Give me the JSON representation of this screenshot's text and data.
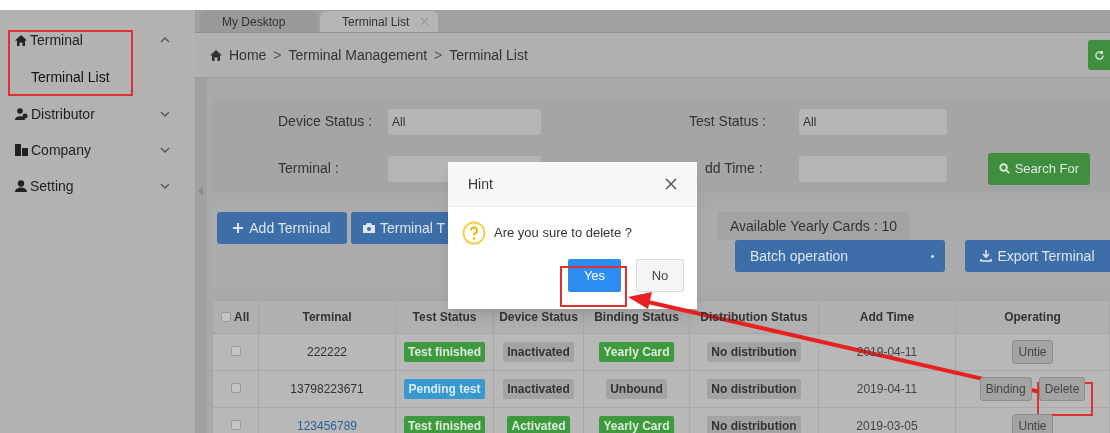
{
  "sidebar": {
    "items": [
      {
        "label": "Terminal",
        "expanded": true,
        "children": [
          {
            "label": "Terminal List",
            "selected": true
          }
        ]
      },
      {
        "label": "Distributor",
        "expanded": false
      },
      {
        "label": "Company",
        "expanded": false
      },
      {
        "label": "Setting",
        "expanded": false
      }
    ]
  },
  "tabs": [
    {
      "label": "My Desktop",
      "selected": false,
      "closable": false
    },
    {
      "label": "Terminal List",
      "selected": true,
      "closable": true
    }
  ],
  "breadcrumb": {
    "items": [
      "Home",
      "Terminal Management",
      "Terminal List"
    ],
    "separator": ">"
  },
  "filters": [
    {
      "label": "Device Status :",
      "value": "All"
    },
    {
      "label": "Test Status :",
      "value": "All"
    },
    {
      "label": "Terminal :"
    },
    {
      "label": "dd Time :"
    }
  ],
  "search_button": "Search For",
  "toolbar": {
    "buttons": [
      "Add Terminal",
      "Terminal T"
    ],
    "yearly_cards": "Available Yearly Cards : 10",
    "batch": "Batch operation",
    "export": "Export Terminal"
  },
  "table": {
    "columns": [
      "All",
      "Terminal",
      "Test Status",
      "Device Status",
      "Binding Status",
      "Distribution Status",
      "Add Time",
      "Operating"
    ],
    "all_checked": false,
    "rows": [
      {
        "checked": false,
        "terminal": "222222",
        "link": false,
        "test_status": {
          "text": "Test finished",
          "kind": "green"
        },
        "device_status": {
          "text": "Inactivated",
          "kind": "gray"
        },
        "binding_status": {
          "text": "Yearly Card",
          "kind": "green"
        },
        "distribution_status": {
          "text": "No distribution",
          "kind": "gray"
        },
        "add_time": "2019-04-11",
        "actions": [
          "Untie"
        ]
      },
      {
        "checked": false,
        "terminal": "13798223671",
        "link": false,
        "test_status": {
          "text": "Pending test",
          "kind": "blue"
        },
        "device_status": {
          "text": "Inactivated",
          "kind": "gray"
        },
        "binding_status": {
          "text": "Unbound",
          "kind": "gray"
        },
        "distribution_status": {
          "text": "No distribution",
          "kind": "gray"
        },
        "add_time": "2019-04-11",
        "actions": [
          "Binding",
          "Delete"
        ]
      },
      {
        "checked": false,
        "terminal": "123456789",
        "link": true,
        "test_status": {
          "text": "Test finished",
          "kind": "green"
        },
        "device_status": {
          "text": "Activated",
          "kind": "green"
        },
        "binding_status": {
          "text": "Yearly Card",
          "kind": "green"
        },
        "distribution_status": {
          "text": "No distribution",
          "kind": "gray"
        },
        "add_time": "2019-03-05",
        "actions": [
          "Untie"
        ]
      }
    ]
  },
  "dialog": {
    "title": "Hint",
    "message": "Are you sure to delete ?",
    "buttons": [
      {
        "label": "Yes",
        "kind": "primary"
      },
      {
        "label": "No",
        "kind": "default"
      }
    ]
  }
}
